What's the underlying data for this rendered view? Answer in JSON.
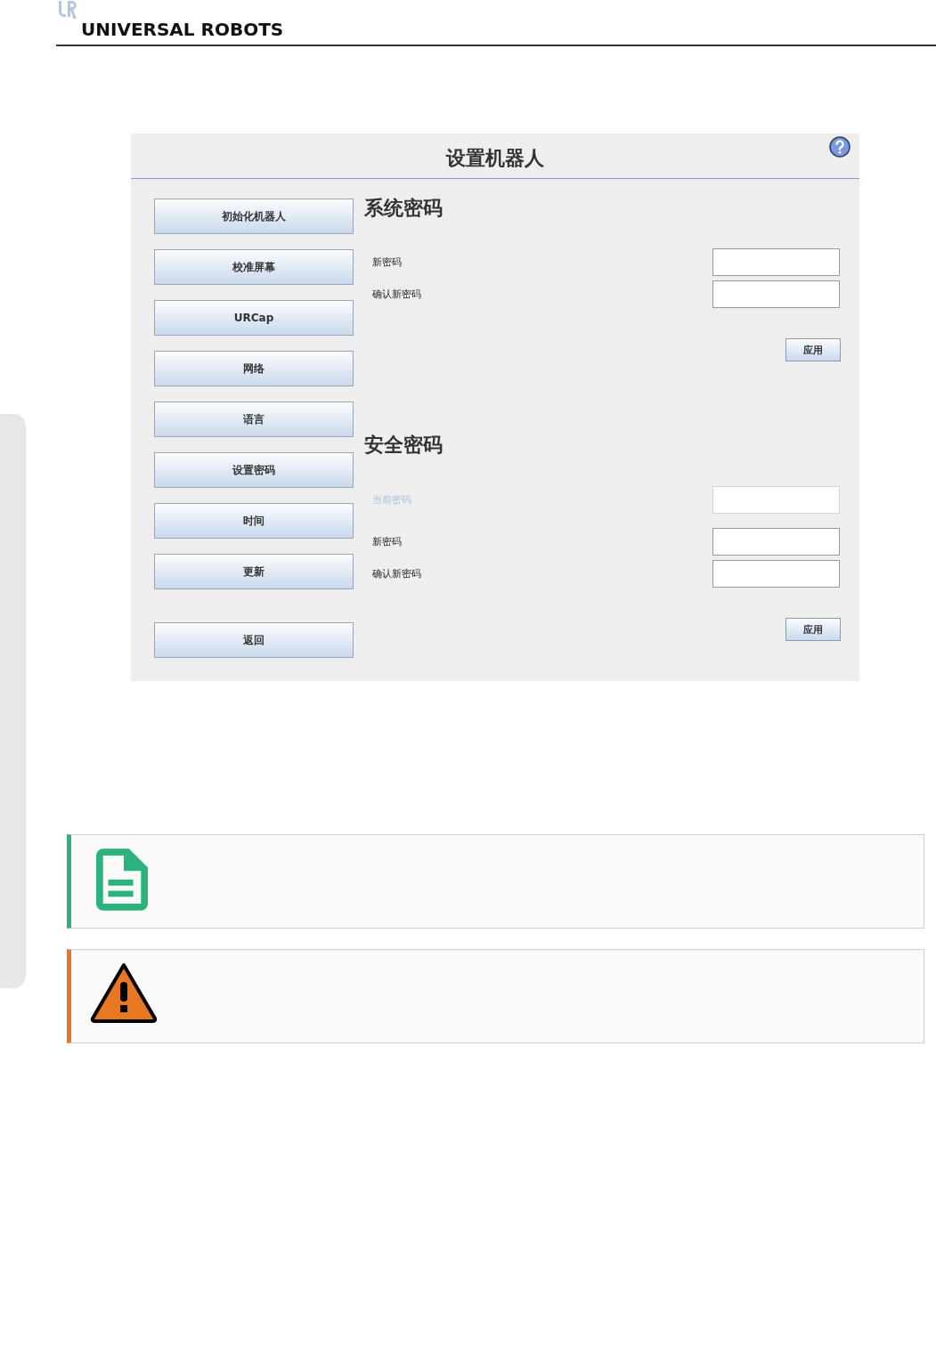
{
  "header": {
    "brand": "UNIVERSAL ROBOTS"
  },
  "panel": {
    "title": "设置机器人",
    "nav_buttons": [
      "初始化机器人",
      "校准屏幕",
      "URCap",
      "网络",
      "语言",
      "设置密码",
      "时间",
      "更新"
    ],
    "back_button": "返回",
    "sections": [
      {
        "title": "系统密码",
        "fields": [
          {
            "label": "新密码",
            "disabled": false
          },
          {
            "label": "确认新密码",
            "disabled": false
          }
        ],
        "apply": "应用"
      },
      {
        "title": "安全密码",
        "fields": [
          {
            "label": "当前密码",
            "disabled": true
          },
          {
            "label": "新密码",
            "disabled": false
          },
          {
            "label": "确认新密码",
            "disabled": false
          }
        ],
        "apply": "应用"
      }
    ]
  },
  "callouts": [
    {
      "kind": "note"
    },
    {
      "kind": "warning"
    }
  ]
}
